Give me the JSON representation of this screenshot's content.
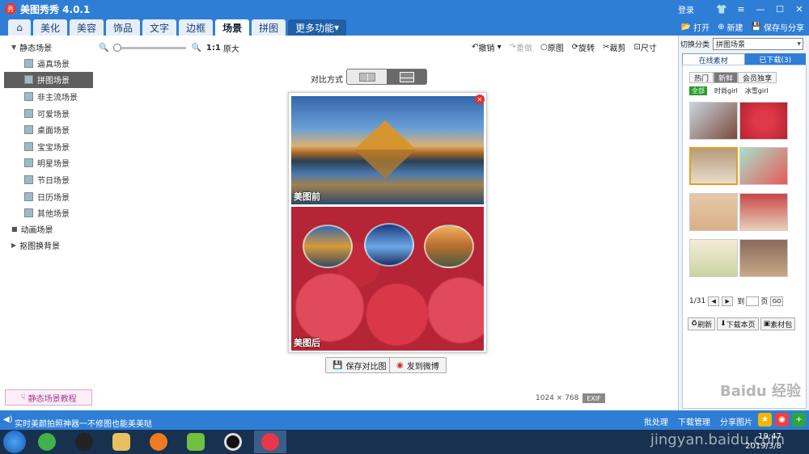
{
  "app": {
    "title": "美图秀秀 4.0.1",
    "login": "登录"
  },
  "menu": {
    "tabs": [
      "美化",
      "美容",
      "饰品",
      "文字",
      "边框",
      "场景",
      "拼图",
      "更多功能"
    ],
    "active": "场景"
  },
  "top_actions": {
    "open": "打开",
    "new": "新建",
    "save": "保存与分享"
  },
  "sidebar": {
    "static_scene": "静态场景",
    "items": [
      "逼真场景",
      "拼图场景",
      "非主流场景",
      "可爱场景",
      "桌面场景",
      "宝宝场景",
      "明星场景",
      "节日场景",
      "日历场景",
      "其他场景"
    ],
    "active_item": "拼图场景",
    "animated_scene": "动画场景",
    "cutout_bg": "抠图换背景",
    "tutorial": "静态场景教程"
  },
  "zoom": {
    "ratio": "1:1",
    "original": "原大"
  },
  "edit_tools": {
    "undo": "撤销",
    "redo": "重做",
    "original": "原图",
    "rotate": "旋转",
    "crop": "裁剪",
    "size": "尺寸"
  },
  "compare": {
    "label": "对比方式",
    "mode": "top-bottom"
  },
  "photos": {
    "before": "美图前",
    "after": "美图后"
  },
  "buttons": {
    "save_compare": "保存对比图",
    "send_weibo": "发到微博"
  },
  "image_info": {
    "width": "1024",
    "times": "×",
    "height": "768",
    "exif": "EXIF"
  },
  "right_panel": {
    "switch_label": "切换分类",
    "switch_value": "拼图场景",
    "tabs": [
      "在线素材",
      "已下载(3)"
    ],
    "filters": [
      "热门",
      "新鲜",
      "会员独享"
    ],
    "active_filter": "新鲜",
    "sub_filters": [
      "全部",
      "时尚girl",
      "冰雪girl"
    ],
    "page": "1/31",
    "to": "到",
    "page_unit": "页",
    "go": "GO",
    "refresh": "刷新",
    "download_page": "下载本页",
    "material_pack": "素材包"
  },
  "status": {
    "message": "实时美颜拍照神器一不修图也能美美哒",
    "batch": "批处理",
    "download_mgr": "下载管理",
    "share": "分享图片"
  },
  "taskbar": {
    "time": "19:47",
    "date": "2019/3/8"
  },
  "watermark": {
    "site": "Baidu 经验",
    "url": "jingyan.baidu.com"
  }
}
